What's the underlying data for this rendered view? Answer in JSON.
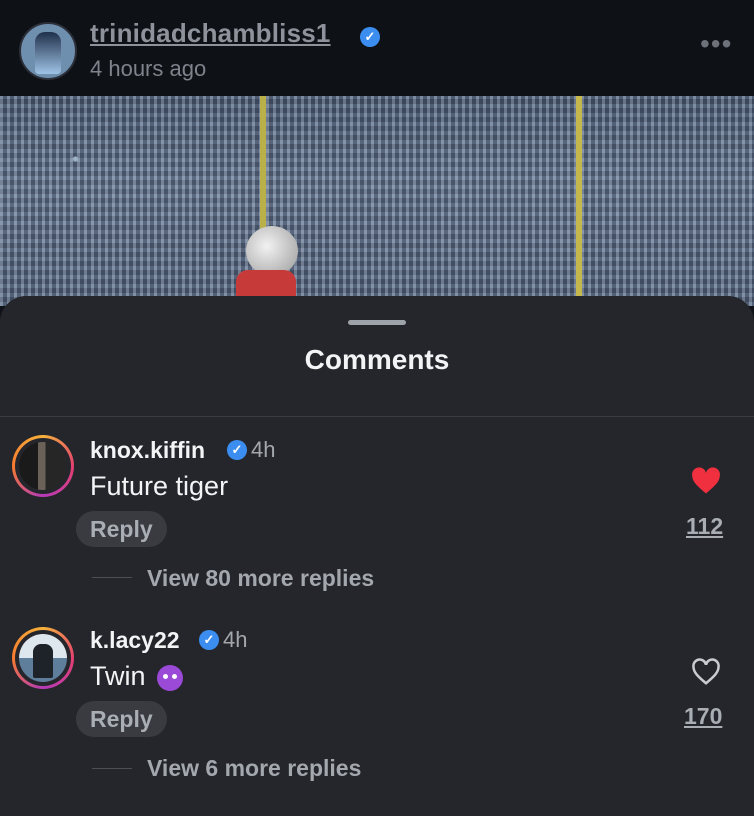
{
  "post": {
    "username": "trinidadchambliss1",
    "time": "4 hours ago",
    "more": "•••"
  },
  "sheet": {
    "title": "Comments"
  },
  "comments": [
    {
      "username": "knox.kiffin",
      "time": "4h",
      "text": "Future tiger",
      "reply_label": "Reply",
      "likes": "112",
      "liked": true,
      "view_replies": "View 80 more replies"
    },
    {
      "username": "k.lacy22",
      "time": "4h",
      "text": "Twin",
      "emoji": "smiling-devil-emoji",
      "reply_label": "Reply",
      "likes": "170",
      "liked": false,
      "view_replies": "View 6 more replies"
    }
  ],
  "colors": {
    "verified": "#3b8ef0",
    "like_red": "#f0303f",
    "sheet_bg": "#25262b"
  }
}
